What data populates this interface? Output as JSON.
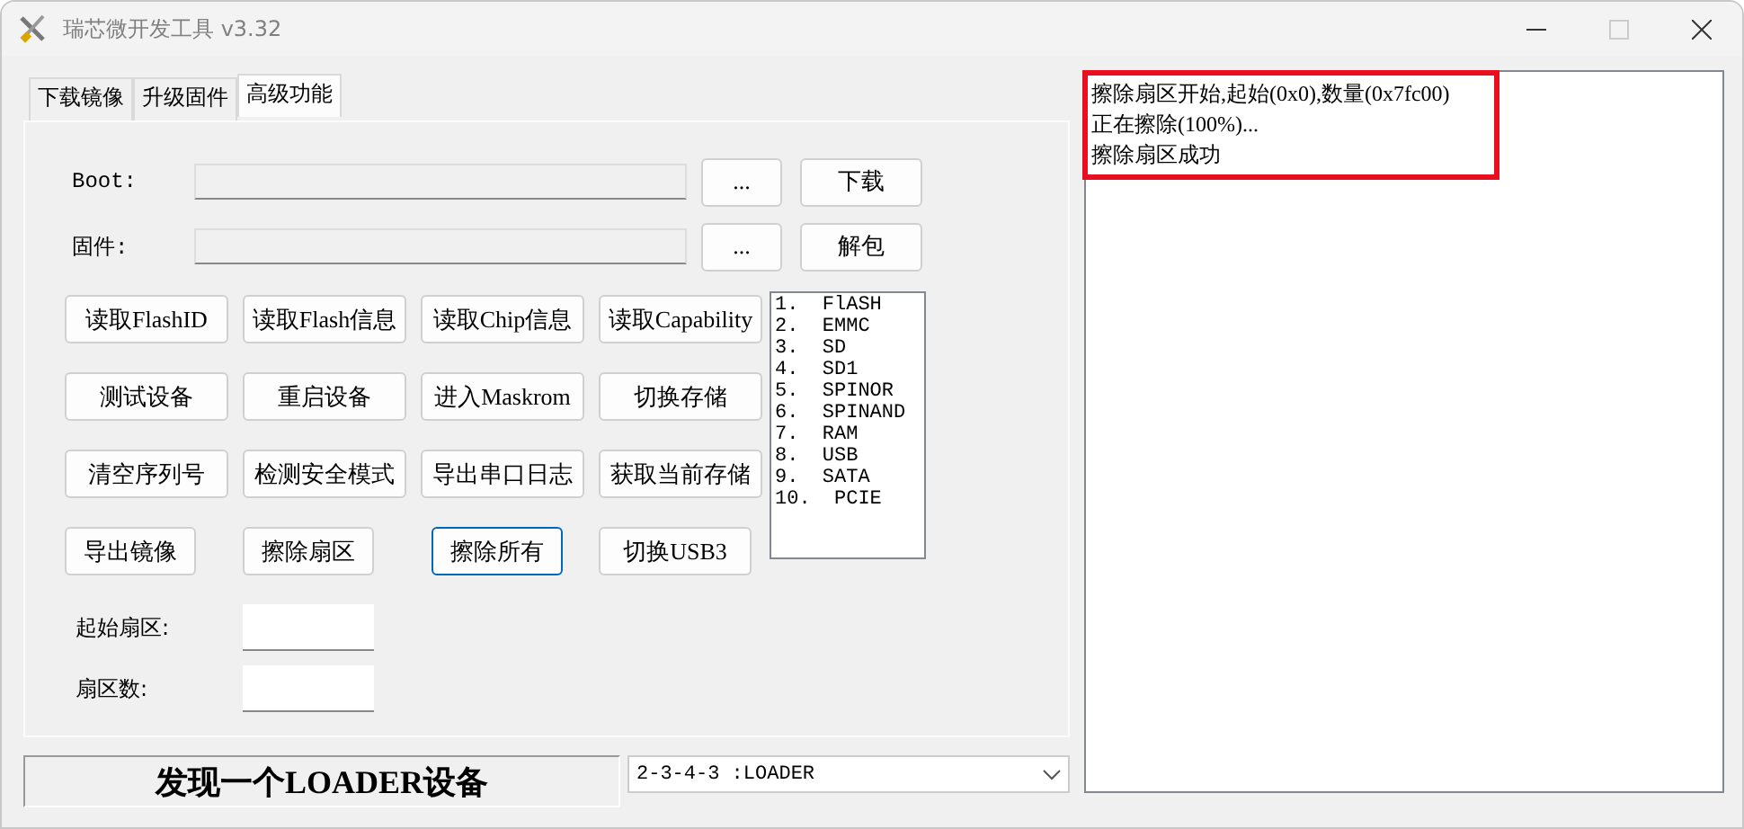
{
  "window": {
    "title": "瑞芯微开发工具 v3.32"
  },
  "tabs": [
    {
      "label": "下载镜像",
      "selected": false
    },
    {
      "label": "升级固件",
      "selected": false
    },
    {
      "label": "高级功能",
      "selected": true
    }
  ],
  "file_rows": [
    {
      "label": "Boot:",
      "browse": "...",
      "action": "下载"
    },
    {
      "label": "固件:",
      "browse": "...",
      "action": "解包"
    }
  ],
  "buttons": [
    {
      "label": "读取FlashID",
      "focused": false
    },
    {
      "label": "读取Flash信息",
      "focused": false
    },
    {
      "label": "读取Chip信息",
      "focused": false
    },
    {
      "label": "读取Capability",
      "focused": false
    },
    {
      "label": "测试设备",
      "focused": false
    },
    {
      "label": "重启设备",
      "focused": false
    },
    {
      "label": "进入Maskrom",
      "focused": false
    },
    {
      "label": "切换存储",
      "focused": false
    },
    {
      "label": "清空序列号",
      "focused": false
    },
    {
      "label": "检测安全模式",
      "focused": false
    },
    {
      "label": "导出串口日志",
      "focused": false
    },
    {
      "label": "获取当前存储",
      "focused": false
    },
    {
      "label": "导出镜像",
      "focused": false
    },
    {
      "label": "擦除扇区",
      "focused": false
    },
    {
      "label": "擦除所有",
      "focused": true
    },
    {
      "label": "切换USB3",
      "focused": false
    }
  ],
  "storage_list": [
    "1.  FlASH",
    "2.  EMMC",
    "3.  SD",
    "4.  SD1",
    "5.  SPINOR",
    "6.  SPINAND",
    "7.  RAM",
    "8.  USB",
    "9.  SATA",
    "10.  PCIE"
  ],
  "sector_fields": [
    {
      "label": "起始扇区:"
    },
    {
      "label": "扇区数:"
    }
  ],
  "status_text": "发现一个LOADER设备",
  "device_select": {
    "value": "2-3-4-3 :LOADER"
  },
  "log_lines": [
    "擦除扇区开始,起始(0x0),数量(0x7fc00)",
    "正在擦除(100%)...",
    "擦除扇区成功"
  ]
}
